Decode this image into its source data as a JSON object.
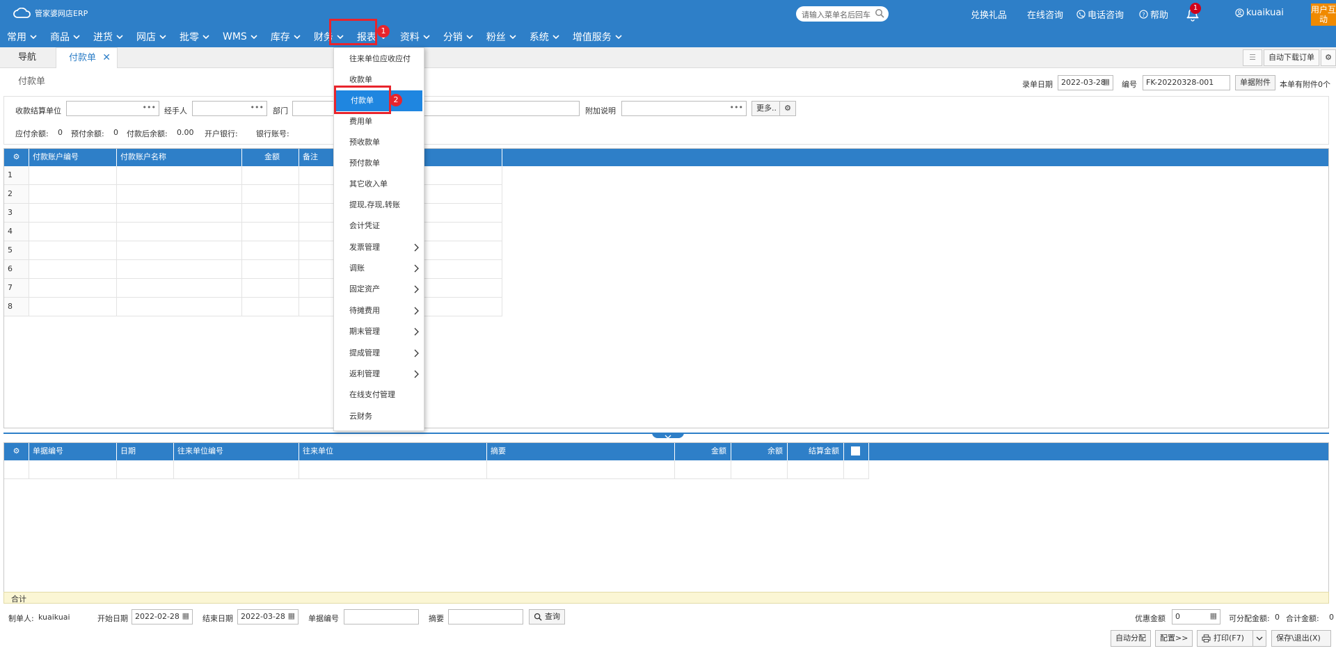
{
  "app": {
    "logo_text": "管家婆网店ERP",
    "search_placeholder": "请输入菜单名后回车",
    "links": {
      "gift": "兑换礼品",
      "online": "在线咨询",
      "phone": "电话咨询",
      "help": "帮助"
    },
    "notification_count": "1",
    "username": "kuaikuai",
    "interact_label": "用户互动"
  },
  "menu": [
    {
      "label": "常用"
    },
    {
      "label": "商品"
    },
    {
      "label": "进货"
    },
    {
      "label": "网店"
    },
    {
      "label": "批零"
    },
    {
      "label": "WMS"
    },
    {
      "label": "库存"
    },
    {
      "label": "财务"
    },
    {
      "label": "报表"
    },
    {
      "label": "资料"
    },
    {
      "label": "分销"
    },
    {
      "label": "粉丝"
    },
    {
      "label": "系统"
    },
    {
      "label": "增值服务"
    }
  ],
  "annotations": {
    "step1": "1",
    "step2": "2"
  },
  "tabs": {
    "nav": "导航",
    "current": "付款单",
    "close": "✕",
    "auto_download": "自动下载订单"
  },
  "page": {
    "title": "付款单",
    "entry_date_label": "录单日期",
    "entry_date": "2022-03-28",
    "number_label": "编号",
    "number": "FK-20220328-001",
    "attach_btn": "单据附件",
    "attach_info": "本单有附件0个"
  },
  "form": {
    "payee_label": "收款结算单位",
    "handler_label": "经手人",
    "dept_label": "部门",
    "extra_label": "附加说明",
    "more_btn": "更多..",
    "dots": "•••",
    "payable_label": "应付余额:",
    "payable": "0",
    "prepaid_label": "预付余额:",
    "prepaid": "0",
    "after_label": "付款后余额:",
    "after": "0.00",
    "bank_label": "开户银行:",
    "account_label": "银行账号:"
  },
  "grid1": {
    "headers": [
      "付款账户编号",
      "付款账户名称",
      "金额",
      "备注"
    ],
    "rows": [
      "1",
      "2",
      "3",
      "4",
      "5",
      "6",
      "7",
      "8"
    ]
  },
  "grid2": {
    "headers": [
      "单据编号",
      "日期",
      "往来单位编号",
      "往来单位",
      "摘要",
      "金额",
      "余额",
      "结算金额"
    ],
    "sum_label": "合计"
  },
  "dropdown": [
    {
      "label": "往来单位应收应付",
      "submenu": false
    },
    {
      "label": "收款单",
      "submenu": false
    },
    {
      "label": "付款单",
      "submenu": false
    },
    {
      "label": "费用单",
      "submenu": false
    },
    {
      "label": "预收款单",
      "submenu": false
    },
    {
      "label": "预付款单",
      "submenu": false
    },
    {
      "label": "其它收入单",
      "submenu": false
    },
    {
      "label": "提现,存现,转账",
      "submenu": false
    },
    {
      "label": "会计凭证",
      "submenu": false
    },
    {
      "label": "发票管理",
      "submenu": true
    },
    {
      "label": "调账",
      "submenu": true
    },
    {
      "label": "固定资产",
      "submenu": true
    },
    {
      "label": "待摊费用",
      "submenu": true
    },
    {
      "label": "期末管理",
      "submenu": true
    },
    {
      "label": "提成管理",
      "submenu": true
    },
    {
      "label": "返利管理",
      "submenu": true
    },
    {
      "label": "在线支付管理",
      "submenu": false
    },
    {
      "label": "云财务",
      "submenu": false
    }
  ],
  "footer": {
    "maker_label": "制单人:",
    "maker": "kuaikuai",
    "start_label": "开始日期",
    "start": "2022-02-28",
    "end_label": "结束日期",
    "end": "2022-03-28",
    "doc_no_label": "单据编号",
    "summary_label": "摘要",
    "query_btn": "查询",
    "discount_label": "优惠金额",
    "discount": "0",
    "allocatable_label": "可分配金额:",
    "allocatable": "0",
    "total_label": "合计金额:",
    "total": "0",
    "auto_alloc": "自动分配",
    "config": "配置>>",
    "print": "打印(F7)",
    "save_exit": "保存\\退出(X)"
  },
  "colors": {
    "primary": "#2e7fc8",
    "highlight": "#1f86e0",
    "annotation": "#e8242c",
    "interact": "#f08a00"
  }
}
